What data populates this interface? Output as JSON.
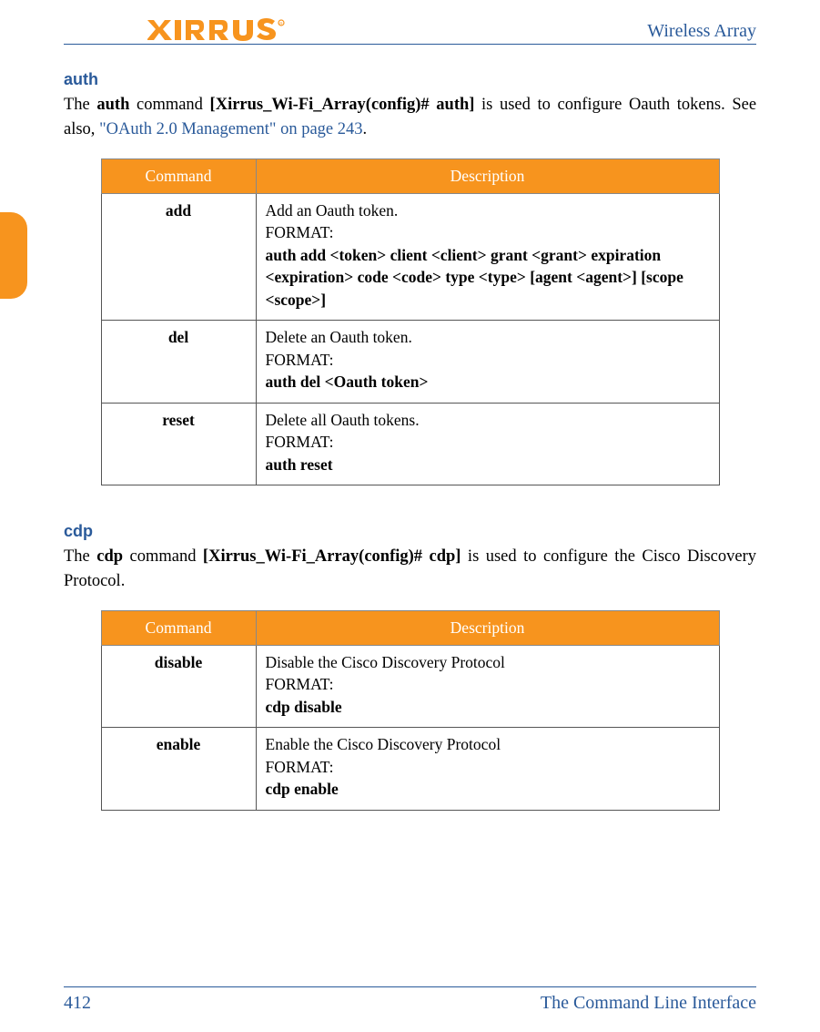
{
  "header": {
    "product_name": "Wireless Array"
  },
  "sections": {
    "auth": {
      "heading": "auth",
      "p1_pre": "The ",
      "p1_cmd": "auth",
      "p1_mid": " command ",
      "p1_prompt": "[Xirrus_Wi-Fi_Array(config)# auth]",
      "p1_post": " is used to configure Oauth tokens. See also, ",
      "p1_xref": "\"OAuth 2.0 Management\" on page 243",
      "p1_end": "."
    },
    "cdp": {
      "heading": "cdp",
      "p1_pre": "The ",
      "p1_cmd": "cdp",
      "p1_mid": " command ",
      "p1_prompt": "[Xirrus_Wi-Fi_Array(config)# cdp]",
      "p1_post": " is used to configure the Cisco Discovery Protocol."
    }
  },
  "table_headers": {
    "cmd": "Command",
    "desc": "Description"
  },
  "auth_table": [
    {
      "cmd": "add",
      "desc1": "Add an Oauth token.",
      "fmt_lbl": "FORMAT:",
      "fmt": "auth add <token> client <client> grant <grant> expiration <expiration> code <code> type <type> [agent <agent>] [scope <scope>]"
    },
    {
      "cmd": "del",
      "desc1": "Delete an Oauth token.",
      "fmt_lbl": "FORMAT:",
      "fmt": "auth del <Oauth token>"
    },
    {
      "cmd": "reset",
      "desc1": "Delete all Oauth tokens.",
      "fmt_lbl": "FORMAT:",
      "fmt": "auth reset"
    }
  ],
  "cdp_table": [
    {
      "cmd": "disable",
      "desc1": "Disable the Cisco Discovery Protocol",
      "fmt_lbl": "FORMAT:",
      "fmt": "cdp disable"
    },
    {
      "cmd": "enable",
      "desc1": "Enable the Cisco Discovery Protocol",
      "fmt_lbl": "FORMAT:",
      "fmt": "cdp enable"
    }
  ],
  "footer": {
    "page_number": "412",
    "chapter": "The Command Line Interface"
  }
}
